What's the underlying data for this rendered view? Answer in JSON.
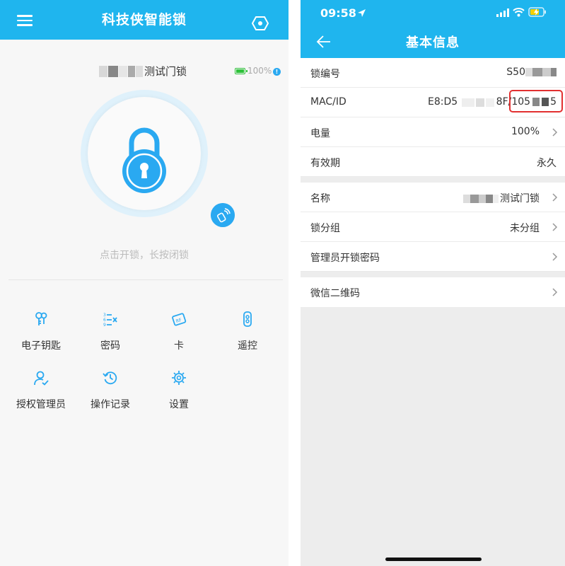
{
  "left": {
    "title": "科技侠智能锁",
    "lock_name": "测试门锁",
    "battery": "100%",
    "hint": "点击开锁，长按闭锁",
    "functions": [
      {
        "label": "电子钥匙",
        "icon": "key-icon"
      },
      {
        "label": "密码",
        "icon": "password-icon"
      },
      {
        "label": "卡",
        "icon": "card-icon"
      },
      {
        "label": "遥控",
        "icon": "remote-icon"
      },
      {
        "label": "授权管理员",
        "icon": "admin-icon"
      },
      {
        "label": "操作记录",
        "icon": "history-icon"
      },
      {
        "label": "设置",
        "icon": "gear-icon"
      }
    ]
  },
  "right": {
    "status_time": "09:58",
    "title": "基本信息",
    "lock_no": {
      "label": "锁编号",
      "value": "S50"
    },
    "mac": {
      "label": "MAC/ID",
      "value_start": "E8:D5",
      "value_end_a": "8F/105",
      "value_end_b": "5"
    },
    "battery": {
      "label": "电量",
      "value": "100%"
    },
    "validity": {
      "label": "有效期",
      "value": "永久"
    },
    "name": {
      "label": "名称",
      "value": "测试门锁"
    },
    "group": {
      "label": "锁分组",
      "value": "未分组"
    },
    "admin_pwd": {
      "label": "管理员开锁密码"
    },
    "wechat_qr": {
      "label": "微信二维码"
    }
  },
  "colors": {
    "primary": "#1fb5ee",
    "accent": "#2aa9f1",
    "highlight": "#e23030"
  }
}
